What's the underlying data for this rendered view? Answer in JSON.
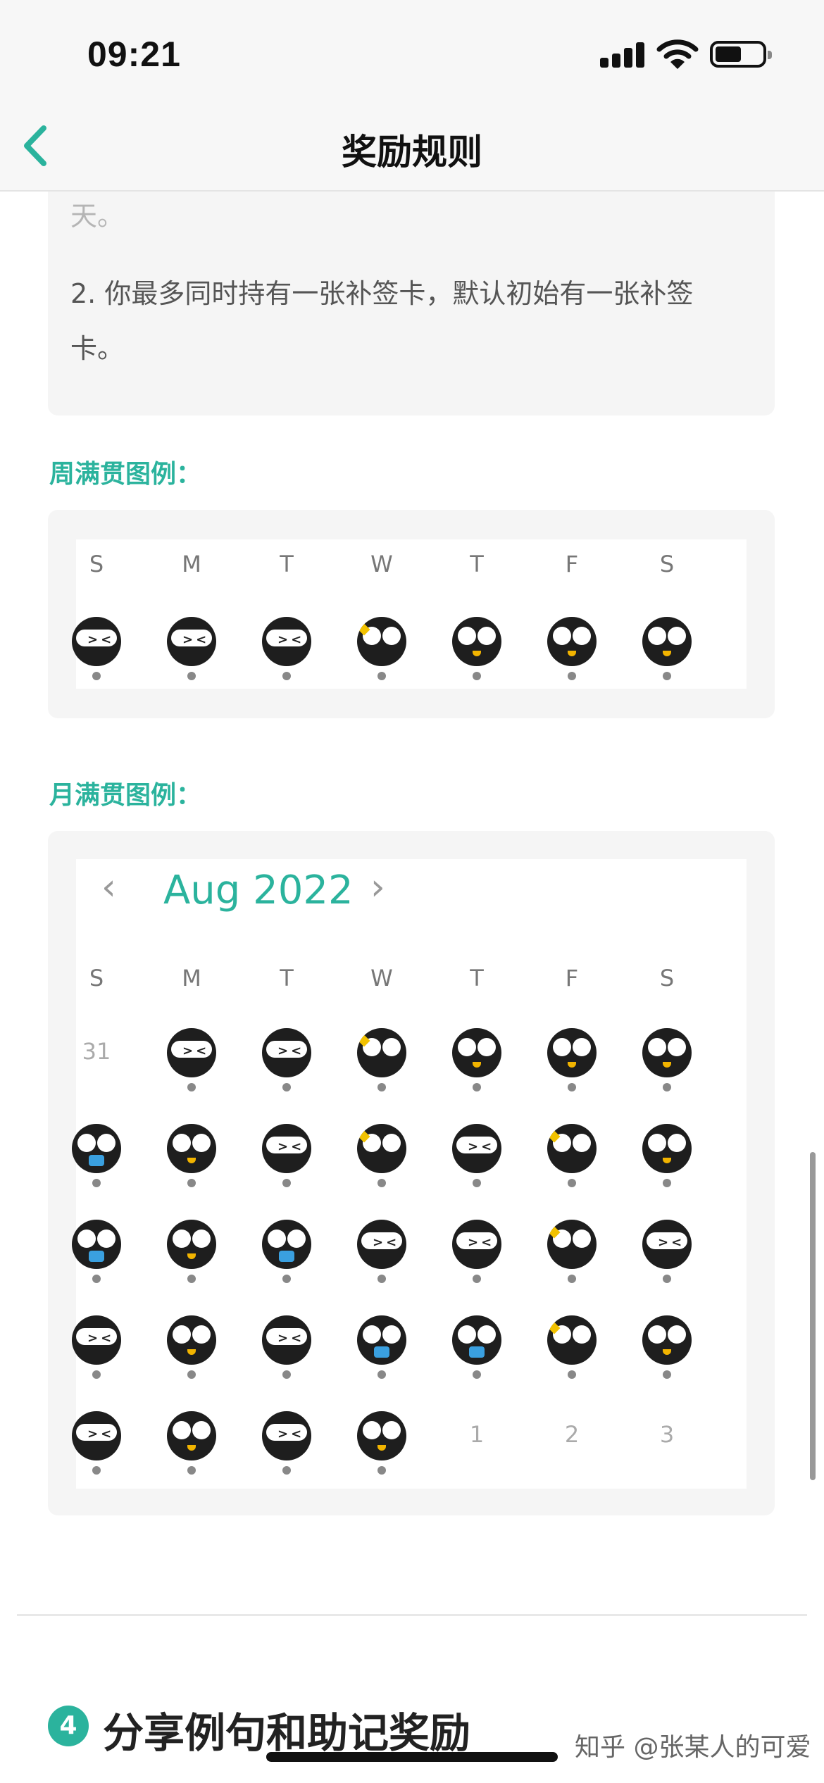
{
  "status_bar": {
    "time": "09:21"
  },
  "header": {
    "title": "奖励规则",
    "back_icon": "chevron-left-icon",
    "accent": "#2bb39d"
  },
  "rules": {
    "faded_tail": "天。",
    "line2a": "2. 你最多同时持有一张补签卡，默认初始有一张补签",
    "line2b": "卡。"
  },
  "week_legend": {
    "heading": "周满贯图例：",
    "weekdays": [
      "S",
      "M",
      "T",
      "W",
      "T",
      "F",
      "S"
    ],
    "owls": [
      "bandana",
      "bandana",
      "bandana",
      "wink-star",
      "happy-beak",
      "happy-beak",
      "happy-beak"
    ]
  },
  "month_legend": {
    "heading": "月满贯图例：",
    "month_label": "Aug 2022",
    "prev_icon": "chevron-left-icon",
    "next_icon": "chevron-right-icon",
    "weekdays": [
      "S",
      "M",
      "T",
      "W",
      "T",
      "F",
      "S"
    ],
    "rows": [
      [
        "31",
        "bandana",
        "bandana",
        "wink-star",
        "happy-beak",
        "happy-beak",
        "happy-beak"
      ],
      [
        "mask",
        "happy-beak",
        "bandana",
        "wink-star",
        "bandana",
        "wink-star",
        "happy-beak"
      ],
      [
        "mask",
        "happy-beak",
        "mask",
        "bandana",
        "bandana",
        "wink-star",
        "bandana"
      ],
      [
        "bandana",
        "happy-beak",
        "bandana",
        "mask",
        "mask",
        "wink-star",
        "happy-beak"
      ],
      [
        "bandana",
        "happy-beak",
        "bandana",
        "happy-beak",
        "1",
        "2",
        "3"
      ]
    ]
  },
  "next_section": {
    "number": "4",
    "title": "分享例句和助记奖励"
  },
  "watermark": "知乎 @张某人的可爱"
}
